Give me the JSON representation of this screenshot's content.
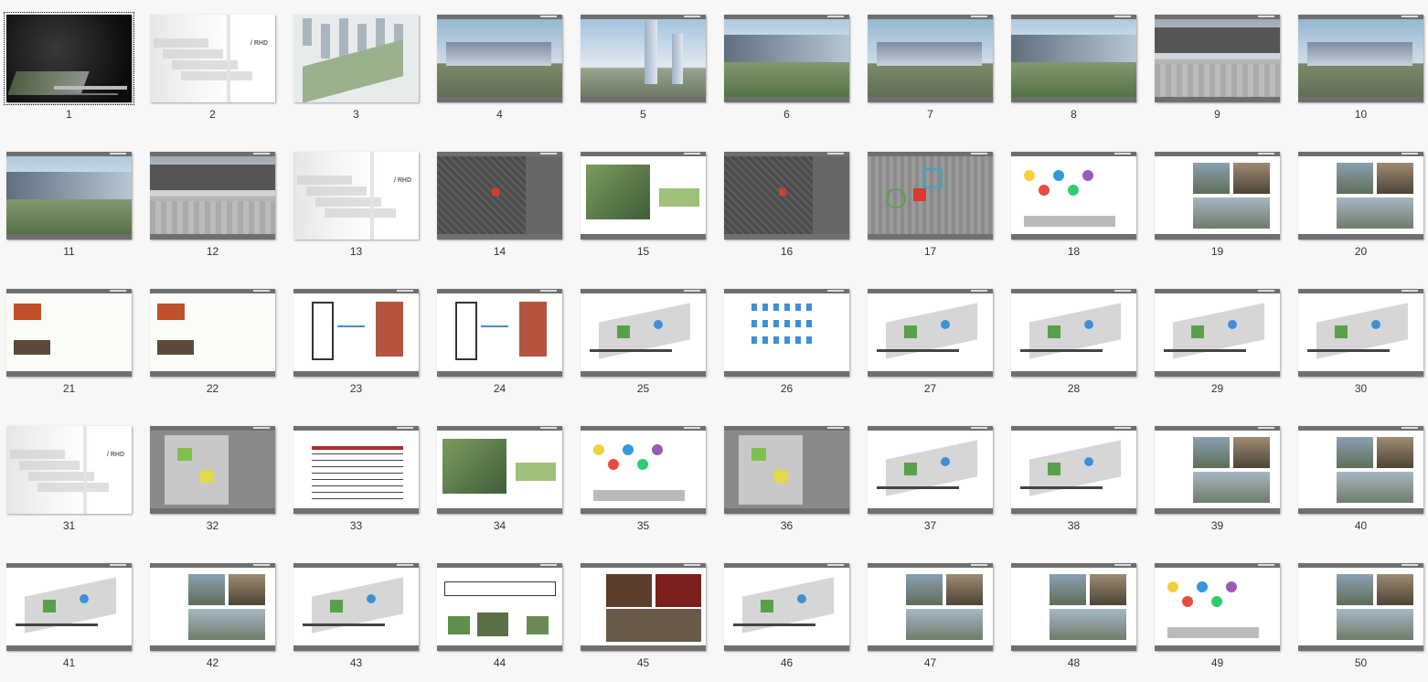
{
  "window": {
    "title": ""
  },
  "grid": {
    "columns": 10,
    "rows": 5,
    "selected_index": 1
  },
  "slides": [
    {
      "n": "1",
      "kind": "dark"
    },
    {
      "n": "2",
      "kind": "cover"
    },
    {
      "n": "3",
      "kind": "aerial"
    },
    {
      "n": "4",
      "kind": "render"
    },
    {
      "n": "5",
      "kind": "towers"
    },
    {
      "n": "6",
      "kind": "render-green"
    },
    {
      "n": "7",
      "kind": "render"
    },
    {
      "n": "8",
      "kind": "render-green"
    },
    {
      "n": "9",
      "kind": "render-dark"
    },
    {
      "n": "10",
      "kind": "render"
    },
    {
      "n": "11",
      "kind": "render-green"
    },
    {
      "n": "12",
      "kind": "render-dark"
    },
    {
      "n": "13",
      "kind": "cover"
    },
    {
      "n": "14",
      "kind": "map-dark"
    },
    {
      "n": "15",
      "kind": "plan-color"
    },
    {
      "n": "16",
      "kind": "map-dark"
    },
    {
      "n": "17",
      "kind": "map-grey"
    },
    {
      "n": "18",
      "kind": "diagram-color"
    },
    {
      "n": "19",
      "kind": "photos"
    },
    {
      "n": "20",
      "kind": "photos"
    },
    {
      "n": "21",
      "kind": "text-photo"
    },
    {
      "n": "22",
      "kind": "text-photo"
    },
    {
      "n": "23",
      "kind": "diagram-red"
    },
    {
      "n": "24",
      "kind": "diagram-red"
    },
    {
      "n": "25",
      "kind": "diagram-iso"
    },
    {
      "n": "26",
      "kind": "diagram-blue"
    },
    {
      "n": "27",
      "kind": "diagram-iso"
    },
    {
      "n": "28",
      "kind": "diagram-iso"
    },
    {
      "n": "29",
      "kind": "diagram-iso"
    },
    {
      "n": "30",
      "kind": "diagram-iso"
    },
    {
      "n": "31",
      "kind": "cover"
    },
    {
      "n": "32",
      "kind": "plan-grey"
    },
    {
      "n": "33",
      "kind": "table"
    },
    {
      "n": "34",
      "kind": "plan-color"
    },
    {
      "n": "35",
      "kind": "diagram-color"
    },
    {
      "n": "36",
      "kind": "plan-grey"
    },
    {
      "n": "37",
      "kind": "diagram-iso"
    },
    {
      "n": "38",
      "kind": "diagram-iso"
    },
    {
      "n": "39",
      "kind": "photos"
    },
    {
      "n": "40",
      "kind": "photos"
    },
    {
      "n": "41",
      "kind": "diagram-iso"
    },
    {
      "n": "42",
      "kind": "photos"
    },
    {
      "n": "43",
      "kind": "diagram-iso"
    },
    {
      "n": "44",
      "kind": "section"
    },
    {
      "n": "45",
      "kind": "photos-dark"
    },
    {
      "n": "46",
      "kind": "diagram-iso"
    },
    {
      "n": "47",
      "kind": "photos"
    },
    {
      "n": "48",
      "kind": "photos"
    },
    {
      "n": "49",
      "kind": "diagram-color"
    },
    {
      "n": "50",
      "kind": "photos"
    }
  ],
  "cover_tag": "/ RHD",
  "colors": {
    "band": "#6f6f6f",
    "accent_red": "#d83a2b",
    "accent_blue": "#3f8fd6",
    "accent_green": "#5aa04a"
  }
}
